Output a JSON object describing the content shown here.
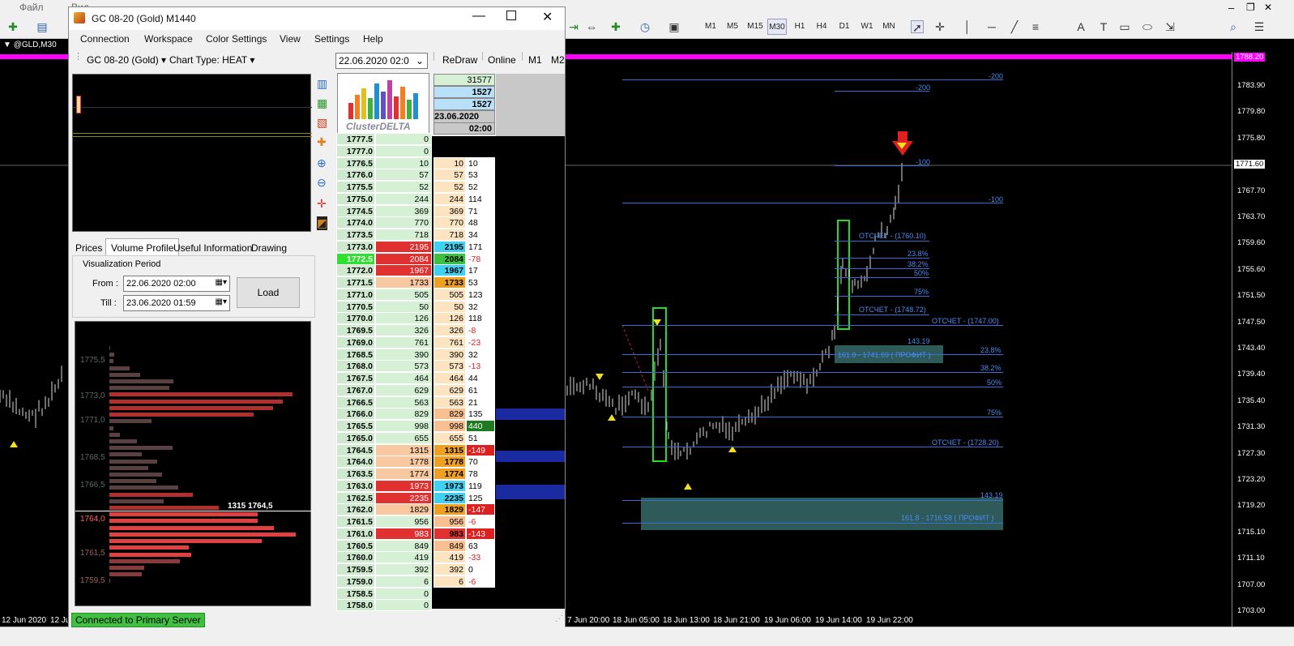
{
  "mt": {
    "menu": [
      "Файл",
      "Вид"
    ],
    "chart_tab": "@GLD,M30",
    "timeframes": [
      "M1",
      "M5",
      "M15",
      "M30",
      "H1",
      "H4",
      "D1",
      "W1",
      "MN"
    ],
    "price_ticks": [
      "1783.90",
      "1779.80",
      "1775.80",
      "1771.60",
      "1767.70",
      "1763.70",
      "1759.60",
      "1755.60",
      "1751.50",
      "1747.50",
      "1743.40",
      "1739.40",
      "1735.40",
      "1731.30",
      "1727.30",
      "1723.20",
      "1719.20",
      "1715.10",
      "1711.10",
      "1707.00",
      "1703.00"
    ],
    "current_price": "1771.60",
    "top_price": "1788.20",
    "time_labels": [
      "12 Jun 2020",
      "12 Ju",
      "7 Jun 20:00",
      "18 Jun 05:00",
      "18 Jun 13:00",
      "18 Jun 21:00",
      "19 Jun 06:00",
      "19 Jun 14:00",
      "19 Jun 22:00"
    ],
    "fib_labels": {
      "m200a": "-200",
      "m200b": "-200",
      "m100a": "-100",
      "m100b": "-100",
      "otchet1": "ОТСЧЕТ - (1760.10)",
      "f238a": "23.8%",
      "f382a": "38.2%",
      "f50a": "50%",
      "f75a": "75%",
      "otchet2": "ОТСЧЕТ - (1748.72)",
      "otchet3": "ОТСЧЕТ - (1747.00)",
      "p14319a": "143.19",
      "f238b": "23.8%",
      "profit1": "161.8 - 1741.69 ( ПРОФИТ )",
      "f382b": "38.2%",
      "f50b": "50%",
      "f75b": "75%",
      "otchet4": "ОТСЧЕТ - (1728.20)",
      "p14319b": "143.19",
      "profit2": "161.8 - 1716.58 ( ПРОФИТ )"
    }
  },
  "cd": {
    "title": "GC 08-20 (Gold) M1440",
    "menu": [
      "Connection",
      "Workspace",
      "Color Settings",
      "View",
      "Settings",
      "Help"
    ],
    "instrument": "GC 08-20 (Gold)",
    "chart_type": "Chart Type: HEAT",
    "date_value": "22.06.2020 02:0",
    "redraw": "ReDraw",
    "online": "Online",
    "tf1": "M1",
    "tf2": "M2",
    "logo_text": "ClusterDELTA",
    "hdr": {
      "total": "31577",
      "b1": "1527",
      "b2": "1527",
      "date": "23.06.2020",
      "time": "02:00"
    },
    "tabs": [
      "Prices",
      "Volume Profile",
      "Useful Information",
      "Drawing"
    ],
    "vis_period": "Visualization Period",
    "from_label": "From :",
    "from_value": "22.06.2020 02:00",
    "till_label": "Till :",
    "till_value": "23.06.2020 01:59",
    "load": "Load",
    "vp_labels": [
      "1775,5",
      "1773,0",
      "1771,0",
      "1768,5",
      "1766,5",
      "1764,0",
      "1761,5",
      "1759,5"
    ],
    "vp_poc": "1315  1764,5",
    "status": "Connected to Primary Server",
    "rows": [
      {
        "p": "1777.5",
        "v": "0"
      },
      {
        "p": "1777.0",
        "v": "0"
      },
      {
        "p": "1776.5",
        "v": "10",
        "b": "10",
        "d": "10"
      },
      {
        "p": "1776.0",
        "v": "57",
        "b": "57",
        "d": "53"
      },
      {
        "p": "1775.5",
        "v": "52",
        "b": "52",
        "d": "52"
      },
      {
        "p": "1775.0",
        "v": "244",
        "b": "244",
        "d": "114"
      },
      {
        "p": "1774.5",
        "v": "369",
        "b": "369",
        "d": "71"
      },
      {
        "p": "1774.0",
        "v": "770",
        "b": "770",
        "d": "48"
      },
      {
        "p": "1773.5",
        "v": "718",
        "b": "718",
        "d": "34"
      },
      {
        "p": "1773.0",
        "v": "2195",
        "b": "2195",
        "d": "171"
      },
      {
        "p": "1772.5",
        "v": "2084",
        "b": "2084",
        "d": "-78"
      },
      {
        "p": "1772.0",
        "v": "1967",
        "b": "1967",
        "d": "17"
      },
      {
        "p": "1771.5",
        "v": "1733",
        "b": "1733",
        "d": "53"
      },
      {
        "p": "1771.0",
        "v": "505",
        "b": "505",
        "d": "123"
      },
      {
        "p": "1770.5",
        "v": "50",
        "b": "50",
        "d": "32"
      },
      {
        "p": "1770.0",
        "v": "126",
        "b": "126",
        "d": "118"
      },
      {
        "p": "1769.5",
        "v": "326",
        "b": "326",
        "d": "-8"
      },
      {
        "p": "1769.0",
        "v": "761",
        "b": "761",
        "d": "-23"
      },
      {
        "p": "1768.5",
        "v": "390",
        "b": "390",
        "d": "32"
      },
      {
        "p": "1768.0",
        "v": "573",
        "b": "573",
        "d": "-13"
      },
      {
        "p": "1767.5",
        "v": "464",
        "b": "464",
        "d": "44"
      },
      {
        "p": "1767.0",
        "v": "629",
        "b": "629",
        "d": "61"
      },
      {
        "p": "1766.5",
        "v": "563",
        "b": "563",
        "d": "21"
      },
      {
        "p": "1766.0",
        "v": "829",
        "b": "829",
        "d": "135"
      },
      {
        "p": "1765.5",
        "v": "998",
        "b": "998",
        "d": "440"
      },
      {
        "p": "1765.0",
        "v": "655",
        "b": "655",
        "d": "51"
      },
      {
        "p": "1764.5",
        "v": "1315",
        "b": "1315",
        "d": "-149"
      },
      {
        "p": "1764.0",
        "v": "1778",
        "b": "1778",
        "d": "70"
      },
      {
        "p": "1763.5",
        "v": "1774",
        "b": "1774",
        "d": "78"
      },
      {
        "p": "1763.0",
        "v": "1973",
        "b": "1973",
        "d": "119"
      },
      {
        "p": "1762.5",
        "v": "2235",
        "b": "2235",
        "d": "125"
      },
      {
        "p": "1762.0",
        "v": "1829",
        "b": "1829",
        "d": "-147"
      },
      {
        "p": "1761.5",
        "v": "956",
        "b": "956",
        "d": "-6"
      },
      {
        "p": "1761.0",
        "v": "983",
        "b": "983",
        "d": "-143"
      },
      {
        "p": "1760.5",
        "v": "849",
        "b": "849",
        "d": "63"
      },
      {
        "p": "1760.0",
        "v": "419",
        "b": "419",
        "d": "-33"
      },
      {
        "p": "1759.5",
        "v": "392",
        "b": "392",
        "d": "0"
      },
      {
        "p": "1759.0",
        "v": "6",
        "b": "6",
        "d": "-6"
      },
      {
        "p": "1758.5",
        "v": "0"
      },
      {
        "p": "1758.0",
        "v": "0"
      }
    ]
  }
}
